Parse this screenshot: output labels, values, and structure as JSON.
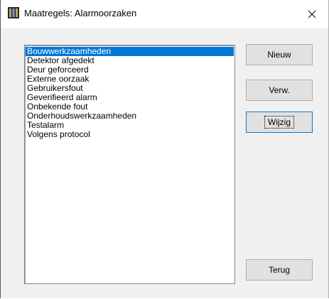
{
  "window": {
    "title": "Maatregels: Alarmoorzaken",
    "close_glyph": "✕"
  },
  "list": {
    "items": [
      "Bouwwerkzaamheden",
      "Detektor afgedekt",
      "Deur geforceerd",
      "Externe oorzaak",
      "Gebruikersfout",
      "Geverifieerd alarm",
      "Onbekende fout",
      "Onderhoudswerkzaamheden",
      "Testalarm",
      "Volgens protocol"
    ],
    "selected_index": 0
  },
  "buttons": {
    "new_label": "Nieuw",
    "delete_label": "Verw.",
    "edit_label": "Wijzig",
    "back_label": "Terug"
  },
  "colors": {
    "selection": "#0078d7",
    "dialog_bg": "#f0f0f0",
    "icon_dark": "#1f2a44",
    "icon_accent": "#c8a24a"
  },
  "icons": {
    "app": "app-icon",
    "close": "close-icon"
  }
}
